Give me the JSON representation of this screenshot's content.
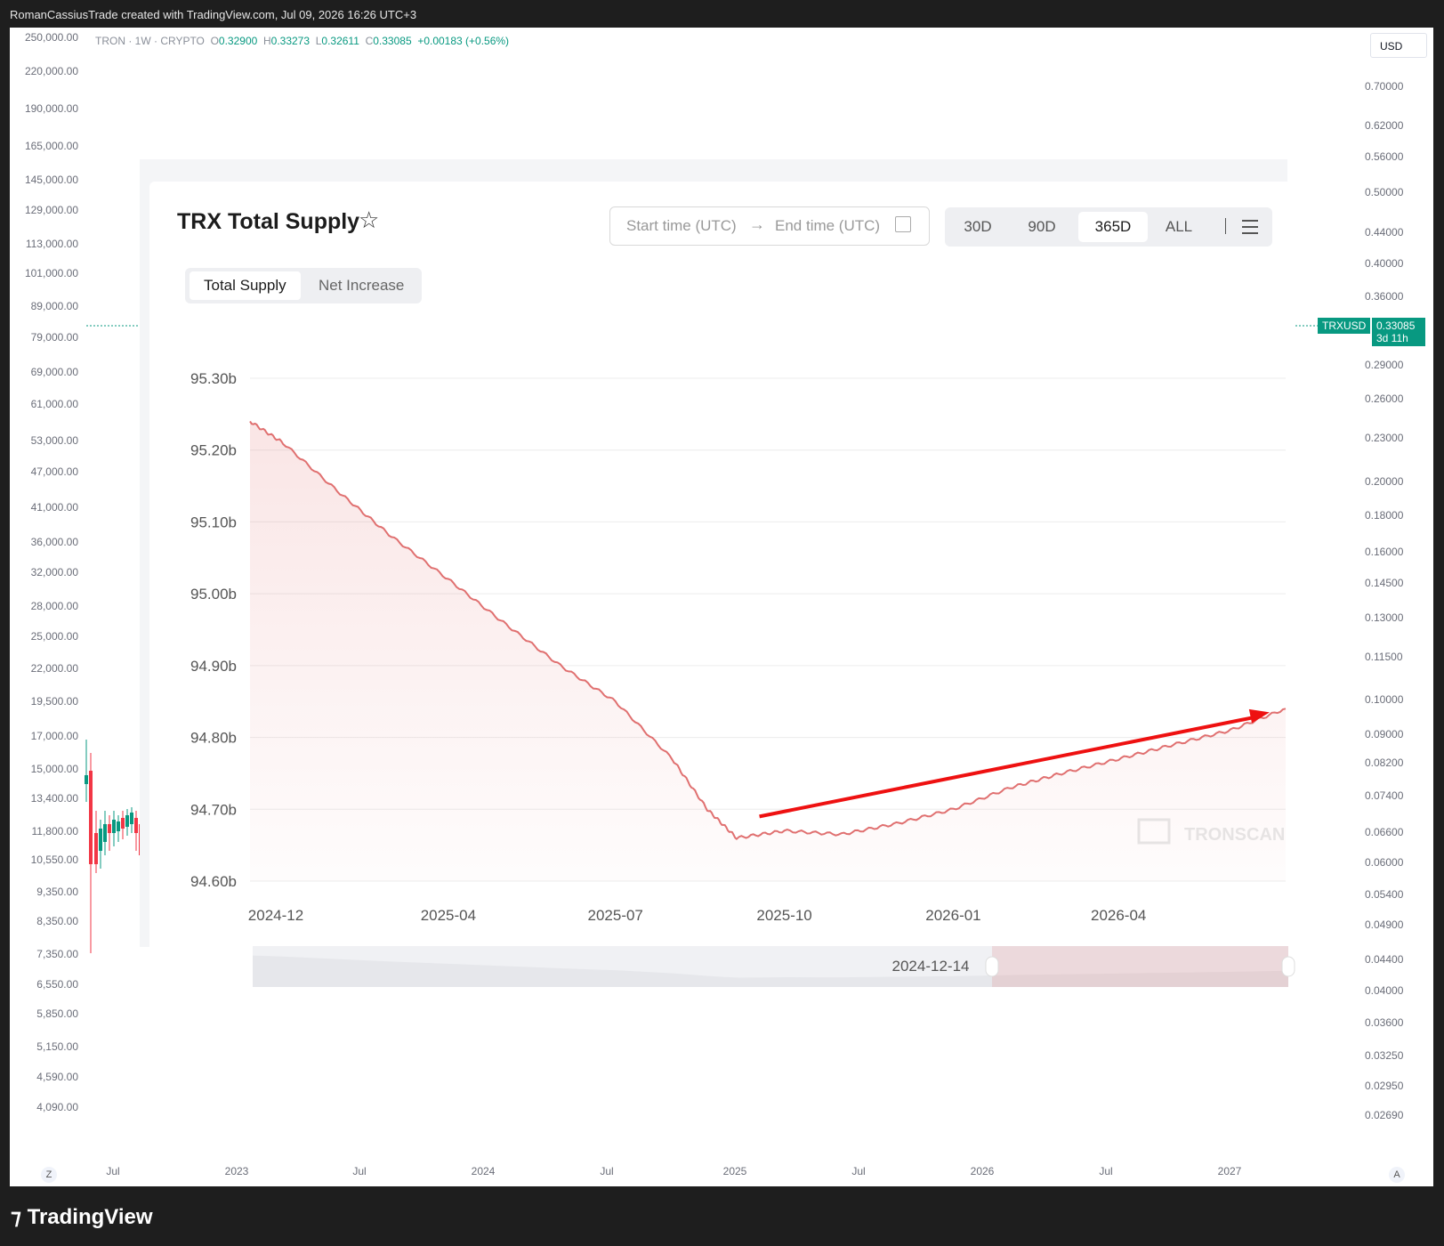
{
  "header": {
    "attribution": "RomanCassiusTrade created with TradingView.com, Jul 09, 2026 16:26 UTC+3"
  },
  "symbol_info": {
    "label": "TRON · 1W · CRYPTO",
    "o_label": "O",
    "o": "0.32900",
    "h_label": "H",
    "h": "0.33273",
    "l_label": "L",
    "l": "0.32611",
    "c_label": "C",
    "c": "0.33085",
    "change": "+0.00183 (+0.56%)"
  },
  "left_axis": [
    "250,000.00",
    "220,000.00",
    "190,000.00",
    "165,000.00",
    "145,000.00",
    "129,000.00",
    "113,000.00",
    "101,000.00",
    "89,000.00",
    "79,000.00",
    "69,000.00",
    "61,000.00",
    "53,000.00",
    "47,000.00",
    "41,000.00",
    "36,000.00",
    "32,000.00",
    "28,000.00",
    "25,000.00",
    "22,000.00",
    "19,500.00",
    "17,000.00",
    "15,000.00",
    "13,400.00",
    "11,800.00",
    "10,550.00",
    "9,350.00",
    "8,350.00",
    "7,350.00",
    "6,550.00",
    "5,850.00",
    "5,150.00",
    "4,590.00",
    "4,090.00"
  ],
  "right_axis": {
    "currency": "USD",
    "labels": [
      "0.70000",
      "0.62000",
      "0.56000",
      "0.50000",
      "0.44000",
      "0.40000",
      "0.36000",
      "0.29000",
      "0.26000",
      "0.23000",
      "0.20000",
      "0.18000",
      "0.16000",
      "0.14500",
      "0.13000",
      "0.11500",
      "0.10000",
      "0.09000",
      "0.08200",
      "0.07400",
      "0.06600",
      "0.06000",
      "0.05400",
      "0.04900",
      "0.04400",
      "0.04000",
      "0.03600",
      "0.03250",
      "0.02950",
      "0.02690"
    ]
  },
  "price_tag": {
    "symbol": "TRXUSD",
    "price": "0.33085",
    "countdown": "3d 11h"
  },
  "time_axis": {
    "labels": [
      "Jul",
      "2023",
      "Jul",
      "2024",
      "Jul",
      "2025",
      "Jul",
      "2026",
      "Jul",
      "2027"
    ],
    "left_button": "Z",
    "right_button": "A"
  },
  "footer": {
    "brand": "TradingView"
  },
  "card": {
    "title": "TRX Total Supply",
    "start_placeholder": "Start time (UTC)",
    "end_placeholder": "End time (UTC)",
    "arrow": "→",
    "ranges": [
      "30D",
      "90D",
      "365D",
      "ALL"
    ],
    "active_range": "365D",
    "tabs": [
      "Total Supply",
      "Net Increase"
    ],
    "active_tab": "Total Supply",
    "watermark": "TRONSCAN",
    "slider_label": "2024-12-14",
    "line_color": "#e07070",
    "arrow_color": "#ee1111"
  },
  "chart_data": {
    "type": "area",
    "title": "TRX Total Supply",
    "xlabel": "",
    "ylabel": "",
    "y_unit": "b",
    "ylim": [
      94.6,
      95.3
    ],
    "y_ticks": [
      "95.30b",
      "95.20b",
      "95.10b",
      "95.00b",
      "94.90b",
      "94.80b",
      "94.70b",
      "94.60b"
    ],
    "x_ticks": [
      "2024-12",
      "2025-04",
      "2025-07",
      "2025-10",
      "2026-01",
      "2026-04"
    ],
    "x": [
      "2024-12-14",
      "2025-01-01",
      "2025-02-01",
      "2025-03-01",
      "2025-04-01",
      "2025-05-01",
      "2025-06-01",
      "2025-07-01",
      "2025-08-01",
      "2025-08-20",
      "2025-09-05",
      "2025-10-01",
      "2025-11-01",
      "2025-12-01",
      "2026-01-01",
      "2026-02-01",
      "2026-03-01",
      "2026-04-01",
      "2026-05-01",
      "2026-06-01",
      "2026-07-01"
    ],
    "values": [
      95.24,
      95.21,
      95.14,
      95.08,
      95.02,
      94.96,
      94.9,
      94.85,
      94.77,
      94.7,
      94.66,
      94.67,
      94.665,
      94.68,
      94.7,
      94.73,
      94.75,
      94.77,
      94.79,
      94.81,
      94.84
    ],
    "annotations": [
      {
        "type": "arrow",
        "from": [
          "2025-10-01",
          94.69
        ],
        "to": [
          "2026-07-01",
          94.835
        ]
      }
    ]
  }
}
